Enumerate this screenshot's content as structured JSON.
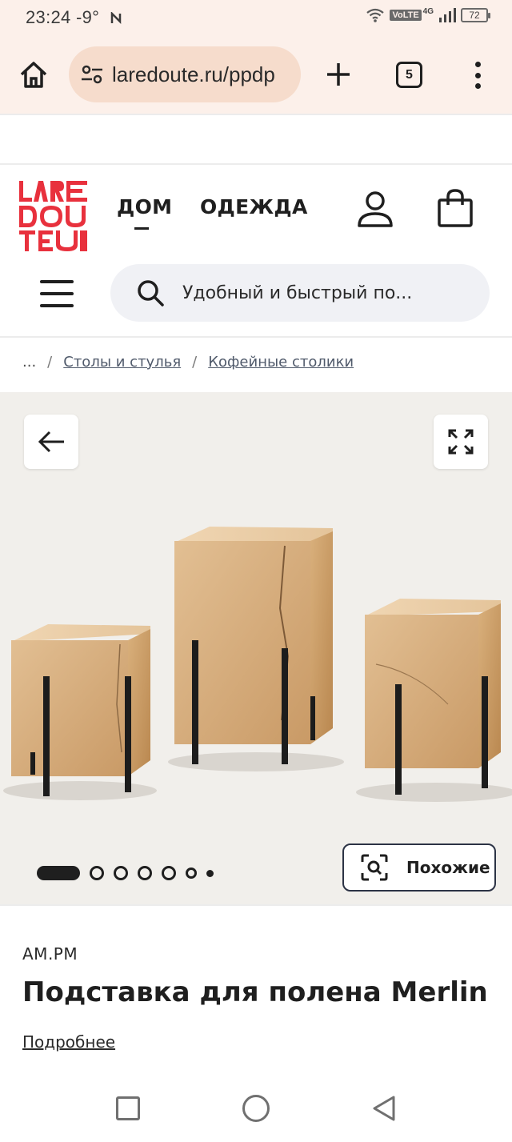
{
  "status_bar": {
    "time": "23:24",
    "temperature": "-9°",
    "network": "4G",
    "volte": "VoLTE",
    "battery": "72"
  },
  "browser": {
    "url": "laredoute.ru/ppdp",
    "tab_count": "5",
    "icons": [
      "home-icon",
      "site-info-icon",
      "new-tab-icon",
      "tabs-icon",
      "menu-dots-icon"
    ]
  },
  "site_header": {
    "logo_lines": [
      "LARE",
      "DOU",
      "TE"
    ],
    "nav": [
      "ДОМ",
      "ОДЕЖДА"
    ],
    "search_placeholder": "Удобный и быстрый по...",
    "brand_color": "#e8313d"
  },
  "breadcrumb": {
    "ellipsis": "...",
    "items": [
      "Столы и стулья",
      "Кофейные столики"
    ],
    "separator": "/"
  },
  "gallery": {
    "total_images": 7,
    "active_index": 0,
    "similar_label": "Похожие"
  },
  "product": {
    "brand": "AM.PM",
    "title": "Подставка для полена Merlin",
    "more_link": "Подробнее"
  }
}
